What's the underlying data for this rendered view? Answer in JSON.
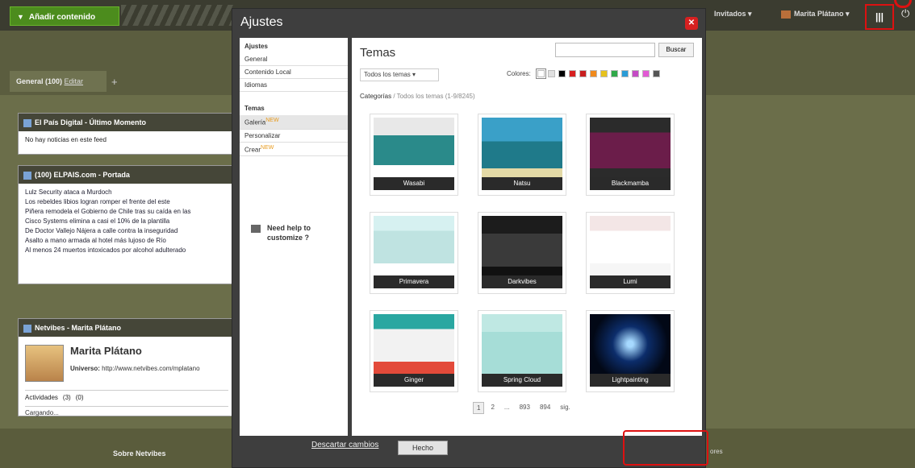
{
  "dashboard": {
    "add_content": "Añadir contenido",
    "invites": "Invitados ▾",
    "user": "Marita Plátano ▾",
    "apps_icon_text": "|||",
    "tab_general": "General (100)",
    "tab_general_edit": "Editar",
    "about": "Sobre Netvibes",
    "bottom_right": "ores"
  },
  "widgets": {
    "w1": {
      "title": "El País Digital - Último Momento",
      "body": "No hay noticias en este feed"
    },
    "w2": {
      "title": "(100) ELPAIS.com - Portada",
      "items": [
        "Lulz Security ataca a Murdoch",
        "Los rebeldes libios logran romper el frente del este",
        "Piñera remodela el Gobierno de Chile tras su caída en las",
        "Cisco Systems elimina a casi el 10% de la plantilla",
        "De Doctor Vallejo Nájera a calle contra la inseguridad",
        "Asalto a mano armada al hotel más lujoso de Río",
        "Al menos 24 muertos intoxicados por alcohol adulterado"
      ]
    },
    "w3": {
      "title": "Netvibes - Marita Plátano",
      "name": "Marita Plátano",
      "universe_label": "Universo:",
      "universe_url": "http://www.netvibes.com/mplatano",
      "tab_activity": "Actividades",
      "tab_count1": "(3)",
      "tab_count2": "(0)",
      "loading": "Cargando..."
    }
  },
  "modal": {
    "title": "Ajustes",
    "sidebar": {
      "section1": "Ajustes",
      "items1": [
        "General",
        "Contenido Local",
        "Idiomas"
      ],
      "section2": "Temas",
      "items2": [
        "Galería",
        "Personalizar",
        "Crear"
      ],
      "new_badge": "NEW",
      "help": "Need help to customize ?"
    },
    "main": {
      "title": "Temas",
      "search_placeholder": "",
      "search_button": "Buscar",
      "filter": "Todos los temas ▾",
      "colors_label": "Colores:",
      "colors": [
        "#ffffff",
        "#e0e0e0",
        "#000000",
        "#d62020",
        "#c81e1e",
        "#f08a1c",
        "#e6c21e",
        "#30a84a",
        "#2a9bd6",
        "#c44bc4",
        "#e25ad4",
        "#555555"
      ],
      "breadcrumb_cat": "Categorías",
      "breadcrumb_rest": "/  Todos los temas (1-9/8245)",
      "themes": [
        "Wasabi",
        "Natsu",
        "Blackmamba",
        "Primavera",
        "Darkvibes",
        "Lumi",
        "Ginger",
        "Spring Cloud",
        "Lightpainting"
      ],
      "pager": [
        "1",
        "2",
        "...",
        "893",
        "894",
        "sig."
      ]
    },
    "discard": "Descartar cambios",
    "done": "Hecho"
  }
}
